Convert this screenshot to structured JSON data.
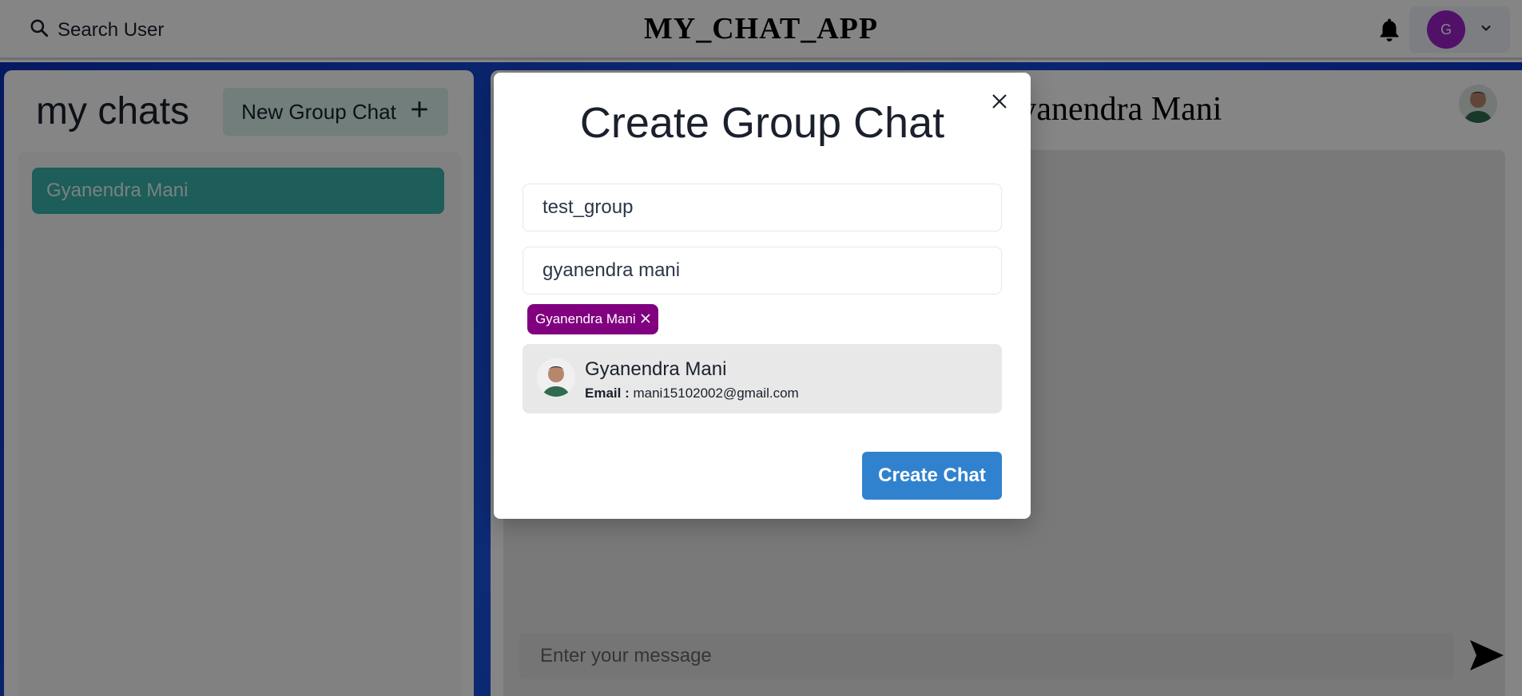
{
  "header": {
    "search_label": "Search User",
    "app_title": "MY_CHAT_APP",
    "avatar_initial": "G"
  },
  "sidebar": {
    "title": "my chats",
    "new_group_label": "New Group Chat",
    "chats": [
      {
        "name": "Gyanendra Mani"
      }
    ]
  },
  "chat": {
    "header_name": "Gyanendra Mani",
    "message_placeholder": "Enter your message"
  },
  "modal": {
    "title": "Create Group Chat",
    "chat_name_value": "test_group",
    "search_users_value": "gyanendra mani",
    "selected_users": [
      {
        "name": "Gyanendra Mani"
      }
    ],
    "results": [
      {
        "name": "Gyanendra Mani",
        "email_label": "Email :",
        "email": "mani15102002@gmail.com"
      }
    ],
    "create_label": "Create Chat"
  },
  "colors": {
    "accent": "#3182ce",
    "chip": "#800080",
    "chat_item": "#38b2ac",
    "avatar": "#9b22c9"
  }
}
